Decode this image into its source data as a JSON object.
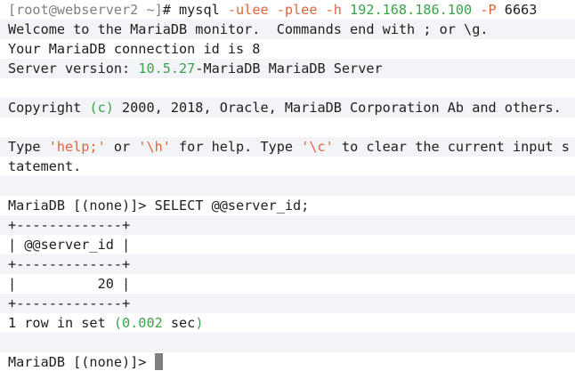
{
  "lines": [
    {
      "parts": [
        {
          "t": "[root@webserver2 ~]",
          "c": "c-gray"
        },
        {
          "t": "# mysql ",
          "c": ""
        },
        {
          "t": "-ulee -plee -h ",
          "c": "c-orange"
        },
        {
          "t": "192.168.186.100 ",
          "c": "c-green"
        },
        {
          "t": "-P ",
          "c": "c-orange"
        },
        {
          "t": "6663",
          "c": ""
        }
      ]
    },
    {
      "parts": [
        {
          "t": "Welcome to the MariaDB monitor.  Commands end with ; or \\g.",
          "c": ""
        }
      ]
    },
    {
      "parts": [
        {
          "t": "Your MariaDB connection id is 8",
          "c": ""
        }
      ]
    },
    {
      "parts": [
        {
          "t": "Server version: ",
          "c": ""
        },
        {
          "t": "10.5.27",
          "c": "c-green"
        },
        {
          "t": "-MariaDB MariaDB Server",
          "c": ""
        }
      ]
    },
    {
      "parts": []
    },
    {
      "parts": [
        {
          "t": "Copyright ",
          "c": ""
        },
        {
          "t": "(c)",
          "c": "c-green"
        },
        {
          "t": " 2000, 2018, Oracle, MariaDB Corporation Ab and others.",
          "c": ""
        }
      ]
    },
    {
      "parts": []
    },
    {
      "parts": [
        {
          "t": "Type ",
          "c": ""
        },
        {
          "t": "'help;'",
          "c": "c-orange"
        },
        {
          "t": " or ",
          "c": ""
        },
        {
          "t": "'\\h'",
          "c": "c-orange"
        },
        {
          "t": " for help. Type ",
          "c": ""
        },
        {
          "t": "'\\c'",
          "c": "c-orange"
        },
        {
          "t": " to clear the current input s",
          "c": ""
        }
      ]
    },
    {
      "parts": [
        {
          "t": "tatement.",
          "c": ""
        }
      ]
    },
    {
      "parts": []
    },
    {
      "parts": [
        {
          "t": "MariaDB [(none)]> SELECT @@server_id;",
          "c": ""
        }
      ]
    },
    {
      "parts": [
        {
          "t": "+-------------+",
          "c": ""
        }
      ]
    },
    {
      "parts": [
        {
          "t": "| @@server_id |",
          "c": ""
        }
      ]
    },
    {
      "parts": [
        {
          "t": "+-------------+",
          "c": ""
        }
      ]
    },
    {
      "parts": [
        {
          "t": "|          20 |",
          "c": ""
        }
      ]
    },
    {
      "parts": [
        {
          "t": "+-------------+",
          "c": ""
        }
      ]
    },
    {
      "parts": [
        {
          "t": "1 row in set ",
          "c": ""
        },
        {
          "t": "(0.002",
          "c": "c-green"
        },
        {
          "t": " sec",
          "c": ""
        },
        {
          "t": ")",
          "c": "c-green"
        }
      ]
    },
    {
      "parts": []
    },
    {
      "parts": [
        {
          "t": "MariaDB [(none)]> ",
          "c": ""
        }
      ],
      "cursor": true
    }
  ],
  "colors": {
    "background": "#ffffff",
    "alt_row": "#f2f4f8",
    "text": "#1e1e1e",
    "prompt_gray": "#7f7f7f",
    "option_orange": "#e0653d",
    "value_green": "#3aa24a",
    "cursor": "#808080"
  }
}
